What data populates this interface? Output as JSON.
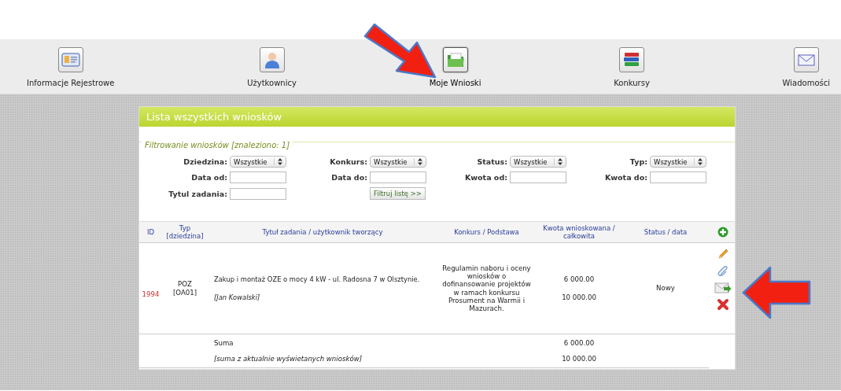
{
  "nav": [
    {
      "label": "Informacje Rejestrowe",
      "selected": false
    },
    {
      "label": "Użytkownicy",
      "selected": false
    },
    {
      "label": "Moje Wnioski",
      "selected": true
    },
    {
      "label": "Konkursy",
      "selected": false
    },
    {
      "label": "Wiadomości",
      "selected": false
    }
  ],
  "panel": {
    "title": "Lista wszystkich wniosków",
    "filter": {
      "legend": "Filtrowanie wniosków [znaleziono: 1]",
      "fields": [
        {
          "label": "Dziedzina:",
          "kind": "select",
          "value": "Wszystkie"
        },
        {
          "label": "Konkurs:",
          "kind": "select",
          "value": "Wszystkie"
        },
        {
          "label": "Status:",
          "kind": "select",
          "value": "Wszystkie"
        },
        {
          "label": "Typ:",
          "kind": "select",
          "value": "Wszystkie"
        },
        {
          "label": "Data od:",
          "kind": "text"
        },
        {
          "label": "Data do:",
          "kind": "text"
        },
        {
          "label": "Kwota od:",
          "kind": "text"
        },
        {
          "label": "Kwota do:",
          "kind": "text"
        },
        {
          "label": "Tytul zadania:",
          "kind": "text"
        },
        {
          "label": "Filtruj listę >>",
          "kind": "button"
        }
      ]
    },
    "table": {
      "columns": [
        "ID",
        "Typ [dziedzina]",
        "Tytuł zadania / użytkownik tworzący",
        "Konkurs / Podstawa",
        "Kwota wnioskowana / całkowita",
        "Status / data"
      ],
      "rows": [
        {
          "id": "1994",
          "type": "POZ",
          "domain": "[OA01]",
          "title": "Zakup i montaż OZE o mocy 4 kW - ul. Radosna 7 w Olsztynie.",
          "user": "[Jan Kowalski]",
          "contest": "Regulamin naboru i oceny wniosków o dofinansowanie projektów w ramach konkursu Prosument na Warmii i Mazurach.",
          "requested": "6 000.00",
          "total": "10 000.00",
          "status": "Nowy"
        }
      ],
      "sum": {
        "label": "Suma",
        "note": "[suma z aktualnie wyświetanych wniosków]",
        "requested": "6 000.00",
        "total": "10 000.00"
      }
    }
  }
}
